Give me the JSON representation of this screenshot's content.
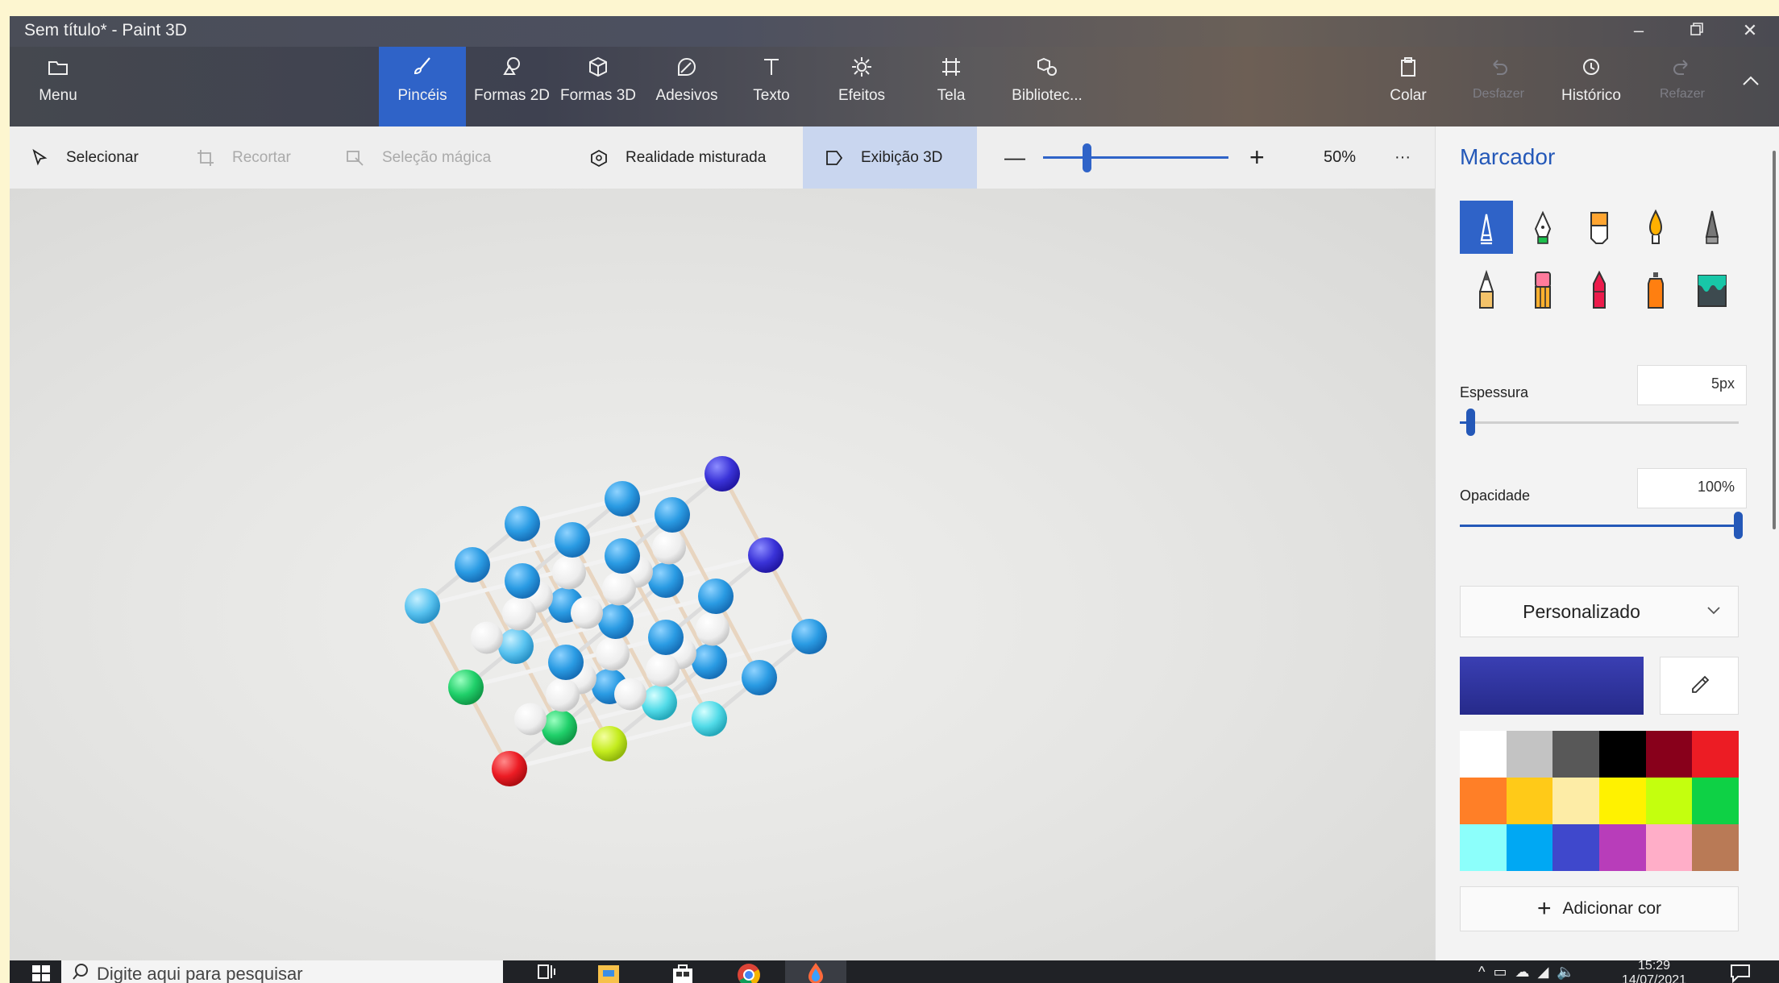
{
  "window": {
    "title": "Sem título* - Paint 3D",
    "minimize_icon": "minimize-icon",
    "maximize_icon": "restore-icon",
    "close_icon": "close-icon"
  },
  "ribbon": {
    "menu_label": "Menu",
    "tools": [
      {
        "label": "Pincéis",
        "icon": "brush-icon",
        "active": true
      },
      {
        "label": "Formas 2D",
        "icon": "shapes-2d-icon"
      },
      {
        "label": "Formas 3D",
        "icon": "cube-icon"
      },
      {
        "label": "Adesivos",
        "icon": "sticker-icon"
      },
      {
        "label": "Texto",
        "icon": "text-icon"
      },
      {
        "label": "Efeitos",
        "icon": "sun-icon"
      },
      {
        "label": "Tela",
        "icon": "canvas-icon"
      },
      {
        "label": "Bibliotec...",
        "icon": "library-icon"
      }
    ],
    "paste_label": "Colar",
    "undo_label": "Desfazer",
    "history_label": "Histórico",
    "redo_label": "Refazer"
  },
  "toolbar": {
    "select_label": "Selecionar",
    "crop_label": "Recortar",
    "magic_select_label": "Seleção mágica",
    "mixed_reality_label": "Realidade misturada",
    "view3d_label": "Exibição 3D",
    "zoom_minus": "—",
    "zoom_plus": "+",
    "zoom_value": "50%",
    "more": "···"
  },
  "panel": {
    "title": "Marcador",
    "brushes": [
      "marker-icon",
      "calligraphy-pen-icon",
      "oil-brush-icon",
      "watercolor-icon",
      "pixel-pen-icon",
      "pencil-icon",
      "eraser-icon",
      "crayon-icon",
      "spray-can-icon",
      "fill-icon"
    ],
    "thickness_label": "Espessura",
    "thickness_value": "5px",
    "thickness_fraction": 0.04,
    "opacity_label": "Opacidade",
    "opacity_value": "100%",
    "opacity_fraction": 1.0,
    "dropdown_value": "Personalizado",
    "current_color": "#3a3fb3",
    "palette": [
      "#ffffff",
      "#c3c3c3",
      "#585858",
      "#000000",
      "#88001b",
      "#ec1c24",
      "#ff7f27",
      "#ffca18",
      "#fdeca6",
      "#fff200",
      "#c4ff0e",
      "#0ed145",
      "#8cfffb",
      "#00a8f3",
      "#3f48cc",
      "#b83dba",
      "#ffaec8",
      "#b97a56"
    ],
    "add_color_label": "Adicionar cor"
  },
  "taskbar": {
    "search_placeholder": "Digite aqui para pesquisar",
    "time": "15:29",
    "date": "14/07/2021"
  }
}
